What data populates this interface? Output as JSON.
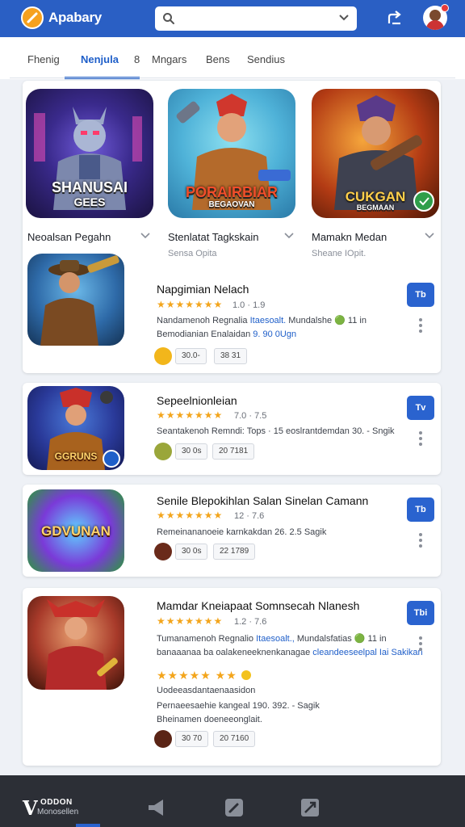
{
  "app": {
    "title": "Apabary"
  },
  "search": {
    "placeholder": ""
  },
  "tabs": [
    "Fhenig",
    "Nenjula",
    "8",
    "Mngars",
    "Bens",
    "Sendius"
  ],
  "featured": [
    {
      "name": "Neoalsan Pegahn",
      "sub": "",
      "art_line1": "SHANUSAI",
      "art_line2": "GEES"
    },
    {
      "name": "Stenlatat Tagkskain",
      "sub": "Sensa Opita",
      "art_line1": "PORAIRBIAR",
      "art_line2": "BEGAOVAN"
    },
    {
      "name": "Mamakn Medan",
      "sub": "Sheane IOpit.",
      "art_line1": "CUKGAN",
      "art_line2": "BEGMAAN"
    }
  ],
  "list": [
    {
      "title": "Napgimian Nelach",
      "rating": "1.0 · 1.9",
      "desc1_a": "Nandamenoh Regnalia ",
      "desc1_hl": "Itaesoalt.",
      "desc1_b": " Mundalshe 🟢 11 in",
      "desc2_a": "Bemodianian Enalaidan ",
      "desc2_hl": "9. 90 0Ugn",
      "chip1": "30.0-",
      "chip2": "38 31",
      "get": "Tb",
      "art": ""
    },
    {
      "title": "Sepeelnionleian",
      "rating": "7.0 · 7.5",
      "desc1_a": "Seantakenoh Remndi: Tops · 15 eoslrantdemdan 30. - Sngik",
      "chip1": "30 0s",
      "chip2": "20 7181",
      "get": "Tv",
      "art": "GGRUNS"
    },
    {
      "title": "Senile Blepokihlan Salan Sinelan Camann",
      "rating": "12 · 7.6",
      "desc1_a": "Remeinananoeie karnkakdan 26. 2.5 Sagik",
      "chip1": "30 0s",
      "chip2": "22 1789",
      "get": "Tb",
      "art": "GDVUNAN"
    },
    {
      "title": "Mamdar Kneiapaat Somnsecah Nlanesh",
      "rating": "1.2 · 7.6",
      "desc1_a": "Tumanamenoh Regnalio ",
      "desc1_hl": "Itaesoalt.,",
      "desc1_b": " Mundalsfatias 🟢 11 in",
      "desc2_a": "banaaanaa ba oalakeneeknenkanagae ",
      "desc2_hl": "cleandeeseelpal Iai Sakikan",
      "desc3_a": "Uodeeasdantaenaasidon",
      "desc4_a": "Pernaeesaehie kangeal 190. 392. - Sagik",
      "desc5_a": "Bheinamen doeneeonglait.",
      "chip1": "30 70",
      "chip2": "20 7160",
      "get": "Tbi",
      "art": ""
    }
  ],
  "bottom_nav": {
    "logo_line1": "ODDON",
    "logo_line2": "Monosellen"
  }
}
